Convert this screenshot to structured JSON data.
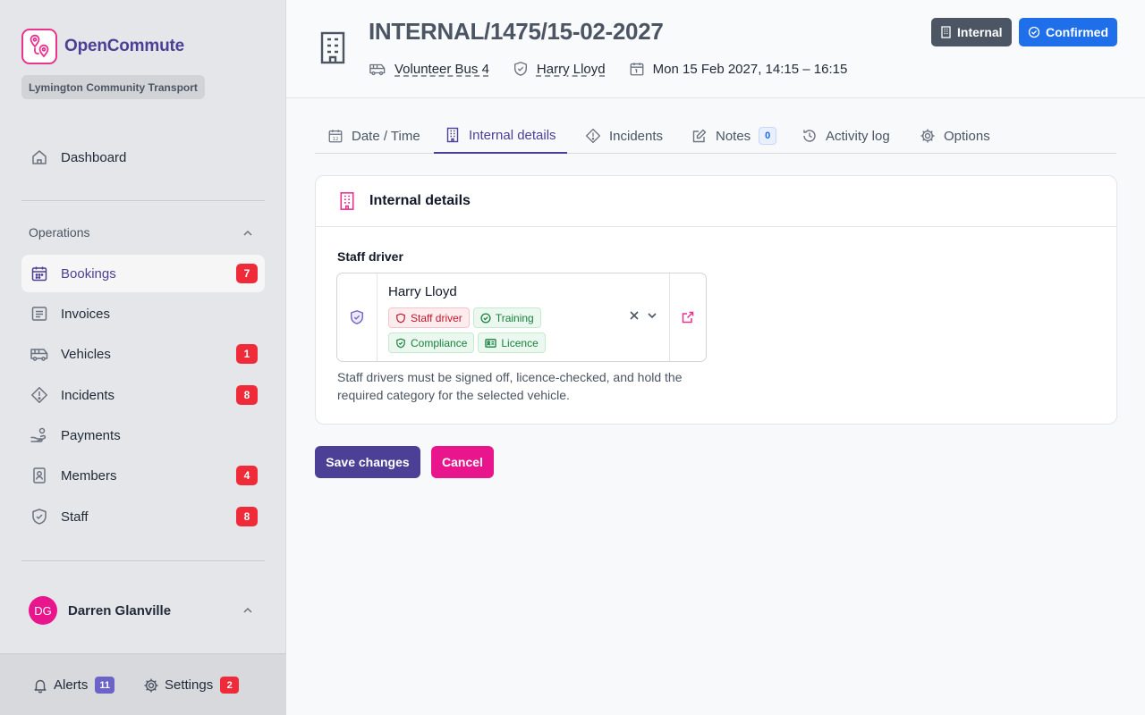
{
  "app": {
    "name": "OpenCommute",
    "org": "Lymington Community Transport"
  },
  "sidebar": {
    "items": [
      {
        "label": "Dashboard",
        "icon": "home-icon"
      },
      {
        "label": "Bookings",
        "icon": "calendar-icon",
        "badge": "7"
      },
      {
        "label": "Invoices",
        "icon": "receipt-icon"
      },
      {
        "label": "Vehicles",
        "icon": "bus-icon",
        "badge": "1"
      },
      {
        "label": "Incidents",
        "icon": "alert-diamond-icon",
        "badge": "8"
      },
      {
        "label": "Payments",
        "icon": "hand-coins-icon"
      },
      {
        "label": "Members",
        "icon": "id-badge-icon",
        "badge": "4"
      },
      {
        "label": "Staff",
        "icon": "shield-icon",
        "badge": "8"
      }
    ],
    "section_title": "Operations",
    "user": {
      "initials": "DG",
      "name": "Darren Glanville"
    },
    "footer": {
      "alerts_label": "Alerts",
      "alerts_count": "11",
      "settings_label": "Settings",
      "settings_count": "2"
    }
  },
  "header": {
    "reference": "INTERNAL/1475/15-02-2027",
    "vehicle": "Volunteer Bus 4",
    "driver": "Harry Lloyd",
    "datetime": "Mon 15 Feb 2027, 14:15 – 16:15",
    "badges": {
      "type": "Internal",
      "status": "Confirmed"
    }
  },
  "tabs": [
    {
      "label": "Date / Time",
      "icon": "calendar-12-icon"
    },
    {
      "label": "Internal details",
      "icon": "building-icon",
      "active": true
    },
    {
      "label": "Incidents",
      "icon": "alert-diamond-icon"
    },
    {
      "label": "Notes",
      "icon": "edit-icon",
      "count": "0"
    },
    {
      "label": "Activity log",
      "icon": "history-icon"
    },
    {
      "label": "Options",
      "icon": "gear-icon"
    }
  ],
  "card": {
    "title": "Internal details",
    "field_label": "Staff driver",
    "selected_name": "Harry Lloyd",
    "chips": [
      "Staff driver",
      "Training",
      "Compliance",
      "Licence"
    ],
    "help_text": "Staff drivers must be signed off, licence-checked, and hold the required category for the selected vehicle."
  },
  "actions": {
    "save": "Save changes",
    "cancel": "Cancel"
  },
  "colors": {
    "primary": "#4c3f96",
    "accent": "#e8158c",
    "badge_red": "#ef2b3a",
    "confirmed_blue": "#1f6feb",
    "internal_gray": "#4b5563"
  }
}
